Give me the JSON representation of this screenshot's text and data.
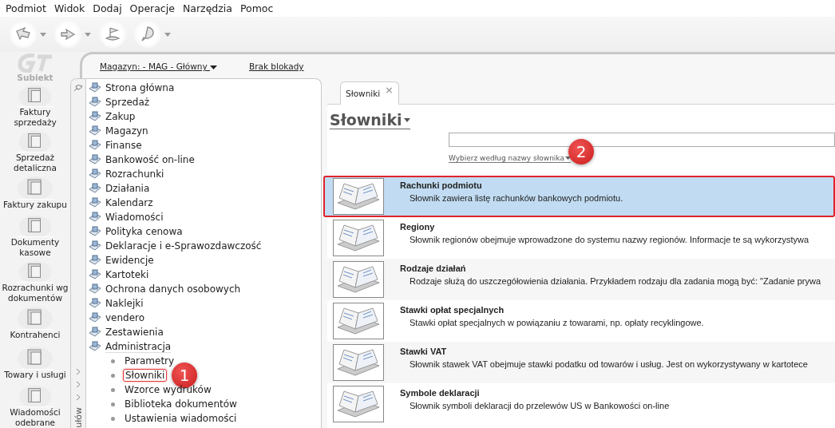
{
  "menu": [
    "Podmiot",
    "Widok",
    "Dodaj",
    "Operacje",
    "Narzędzia",
    "Pomoc"
  ],
  "toolbar": [
    {
      "kind": "back",
      "dropdown": true
    },
    {
      "kind": "forward",
      "dropdown": true
    },
    {
      "kind": "flag",
      "dropdown": false
    },
    {
      "kind": "help",
      "dropdown": true
    }
  ],
  "logo": {
    "name": "Subiekt"
  },
  "infobar": {
    "warehouse": "Magazyn: - MAG - Główny",
    "lock": "Brak blokady"
  },
  "sidebar": [
    {
      "label": "Faktury sprzedaży"
    },
    {
      "label": "Sprzedaż detaliczna"
    },
    {
      "label": "Faktury zakupu"
    },
    {
      "label": "Dokumenty kasowe"
    },
    {
      "label": "Rozrachunki wg dokumentów"
    },
    {
      "label": "Kontrahenci"
    },
    {
      "label": "Towary i usługi"
    },
    {
      "label": "Wiadomości odebrane"
    }
  ],
  "nav_tab_label": "ułów",
  "tree": [
    {
      "label": "Strona główna"
    },
    {
      "label": "Sprzedaż"
    },
    {
      "label": "Zakup"
    },
    {
      "label": "Magazyn"
    },
    {
      "label": "Finanse"
    },
    {
      "label": "Bankowość on-line"
    },
    {
      "label": "Rozrachunki"
    },
    {
      "label": "Działania"
    },
    {
      "label": "Kalendarz"
    },
    {
      "label": "Wiadomości"
    },
    {
      "label": "Polityka cenowa"
    },
    {
      "label": "Deklaracje i e-Sprawozdawczość"
    },
    {
      "label": "Ewidencje"
    },
    {
      "label": "Kartoteki"
    },
    {
      "label": "Ochrona danych osobowych"
    },
    {
      "label": "Naklejki"
    },
    {
      "label": "vendero"
    },
    {
      "label": "Zestawienia"
    },
    {
      "label": "Administracja",
      "expanded": true,
      "children": [
        {
          "label": "Parametry",
          "selected": false
        },
        {
          "label": "Słowniki",
          "selected": true
        },
        {
          "label": "Wzorce wydruków",
          "selected": false
        },
        {
          "label": "Biblioteka dokumentów",
          "selected": false
        },
        {
          "label": "Ustawienia wiadomości",
          "selected": false
        }
      ]
    }
  ],
  "tabs": [
    {
      "label": "Słowniki",
      "selected": true,
      "close": "×"
    }
  ],
  "heading": "Słowniki",
  "search": {
    "hint": "Wybierz według nazwy słownika"
  },
  "dictionaries": [
    {
      "name": "Rachunki podmiotu",
      "description": "Słownik zawiera listę rachunków bankowych podmiotu.",
      "selected": true
    },
    {
      "name": "Regiony",
      "description": "Słownik regionów obejmuje wprowadzone do systemu nazwy regionów. Informacje te są wykorzystywa",
      "selected": false
    },
    {
      "name": "Rodzaje działań",
      "description": "Rodzaje służą do uszczegółowienia działania. Przykładem rodzaju dla zadania mogą być: \"Zadanie prywa",
      "selected": false
    },
    {
      "name": "Stawki opłat specjalnych",
      "description": "Stawki opłat specjalnych w powiązaniu z towarami, np. opłaty recyklingowe.",
      "selected": false
    },
    {
      "name": "Stawki VAT",
      "description": "Słownik stawek VAT obejmuje stawki podatku od towarów i usług. Jest on wykorzystywany w kartotece",
      "selected": false
    },
    {
      "name": "Symbole deklaracji",
      "description": "Słownik symboli deklaracji do przelewów US w Bankowości on-line",
      "selected": false
    }
  ],
  "callouts": [
    {
      "number": "1"
    },
    {
      "number": "2"
    }
  ]
}
